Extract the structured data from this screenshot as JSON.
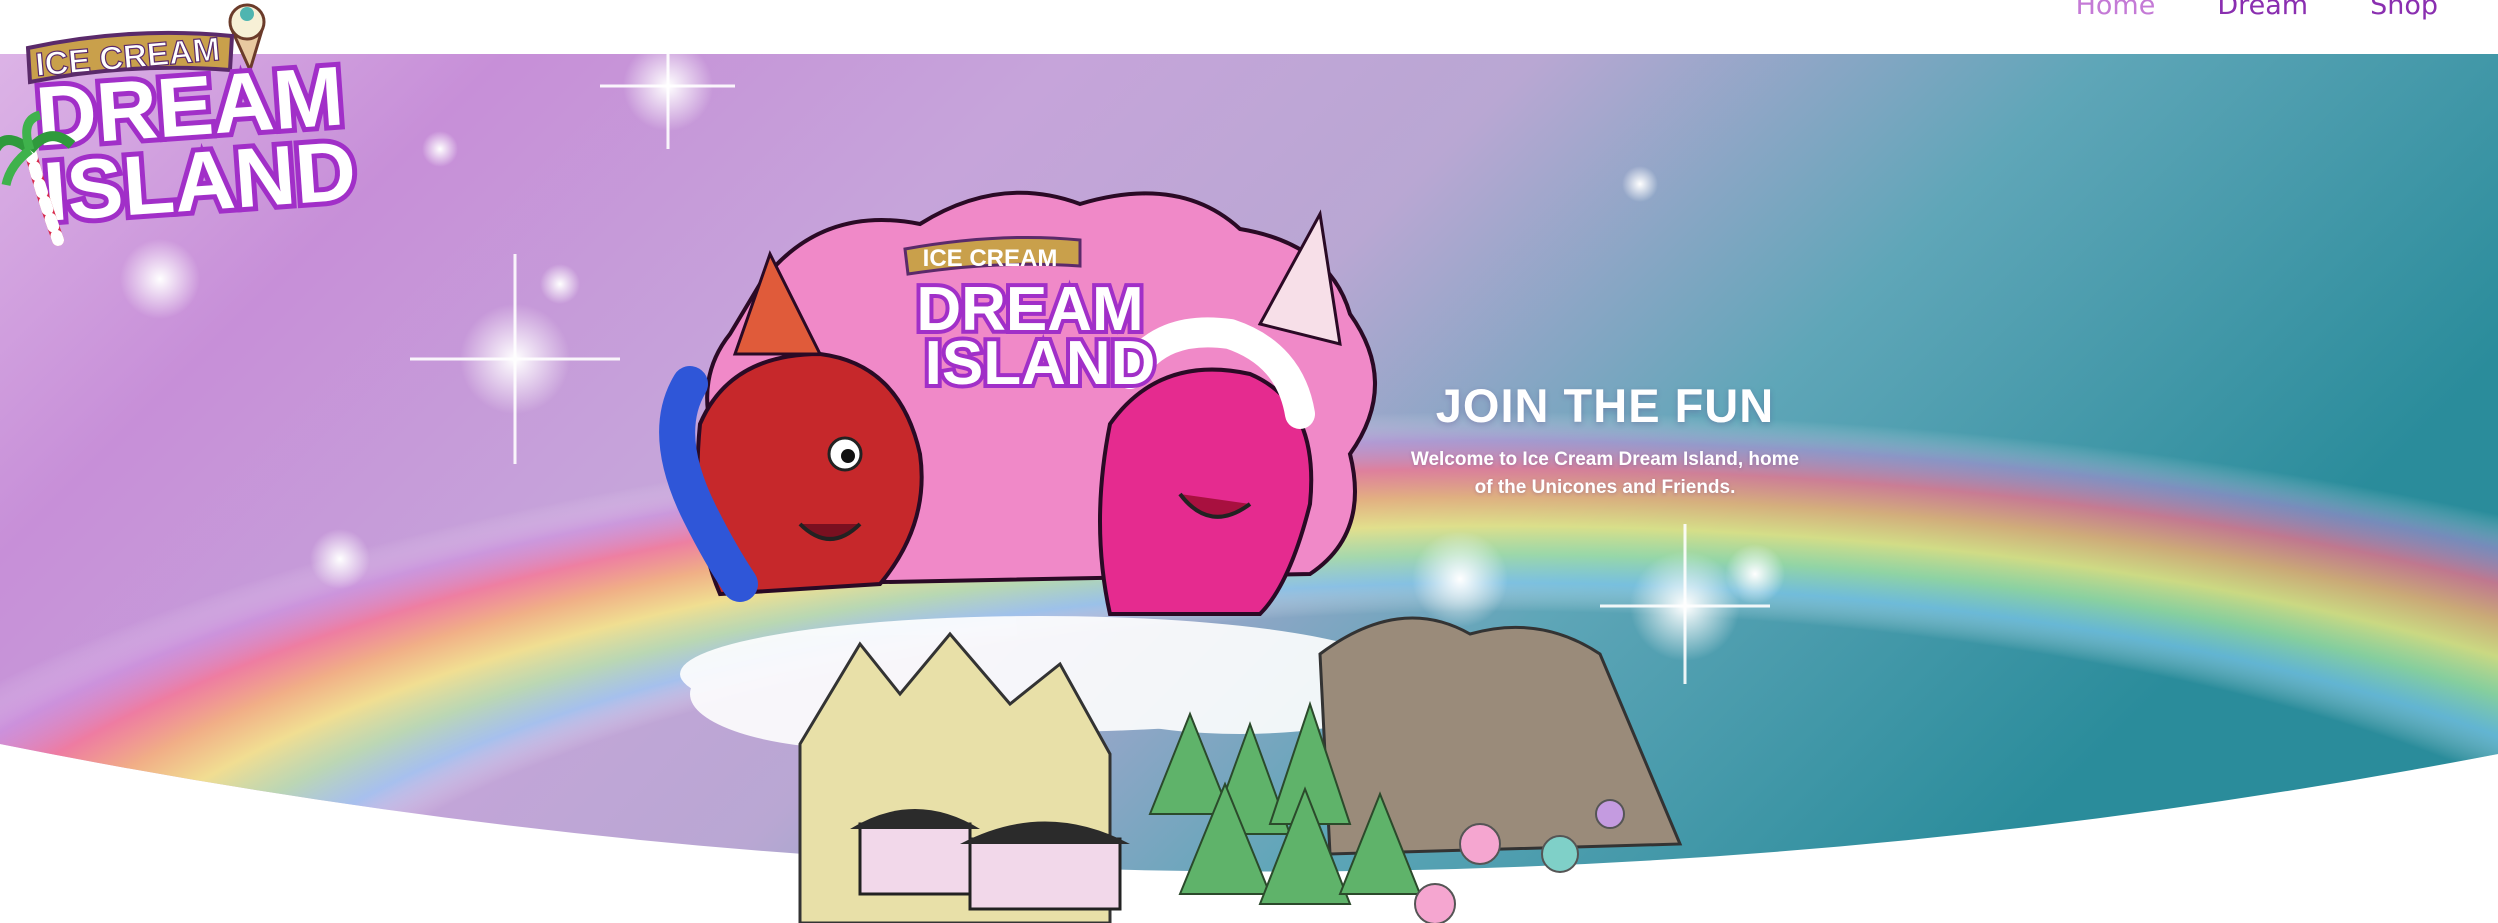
{
  "logo": {
    "line1": "ICE CREAM",
    "line2": "DREAM",
    "line3": "ISLAND"
  },
  "nav": {
    "items": [
      {
        "label": "Home",
        "active": true
      },
      {
        "label": "Dream",
        "active": false
      },
      {
        "label": "Shop",
        "active": false
      }
    ]
  },
  "hero": {
    "art_logo": {
      "line1": "ICE CREAM",
      "line2": "DREAM",
      "line3": "ISLAND"
    },
    "title": "JOIN THE FUN",
    "subtitle_line1": "Welcome to Ice Cream Dream Island, home",
    "subtitle_line2": "of the Unicones and Friends."
  },
  "colors": {
    "nav_link": "#8a2fb0",
    "nav_active": "#c47ad6",
    "logo_purple": "#a12fc8",
    "hero_teal": "#2a8c9b",
    "hero_lilac": "#b7a2d3"
  }
}
